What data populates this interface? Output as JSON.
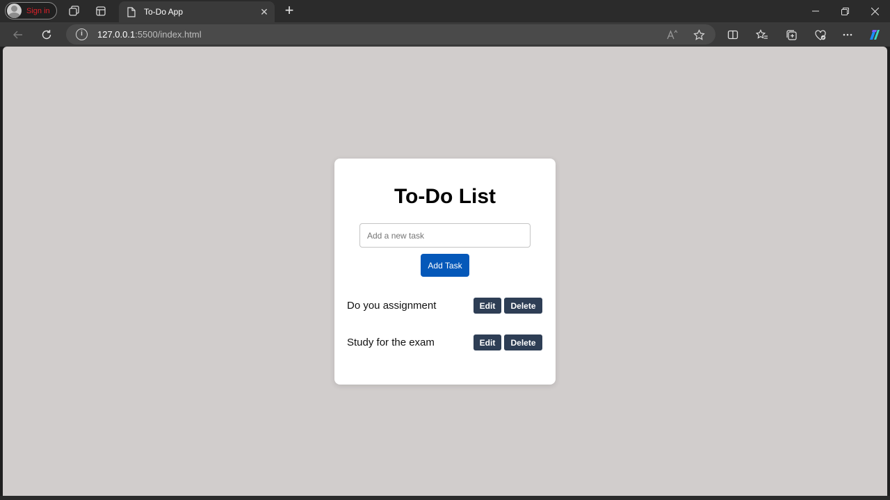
{
  "browser": {
    "profile": {
      "label": "Sign in"
    },
    "tab": {
      "title": "To-Do App",
      "close_glyph": "✕"
    },
    "new_tab_glyph": "+",
    "address": {
      "host": "127.0.0.1",
      "rest": ":5500/index.html",
      "info_glyph": "i"
    },
    "icons": [
      "workspaces-icon",
      "tab-actions-icon",
      "page-icon",
      "read-aloud-icon",
      "favorite-star-icon",
      "split-screen-icon",
      "favorites-icon",
      "collections-icon",
      "browser-essentials-icon",
      "more-icon",
      "copilot-icon"
    ]
  },
  "app": {
    "title": "To-Do List",
    "input_placeholder": "Add a new task",
    "input_value": "",
    "add_button": "Add Task",
    "tasks": [
      {
        "text": "Do you assignment",
        "edit": "Edit",
        "delete": "Delete"
      },
      {
        "text": "Study for the exam",
        "edit": "Edit",
        "delete": "Delete"
      }
    ]
  },
  "colors": {
    "page_background": "#d1cdcc",
    "card_background": "#ffffff",
    "primary_button": "#0558b9",
    "task_button": "#2e3e55",
    "signin_text": "#e0202a"
  }
}
